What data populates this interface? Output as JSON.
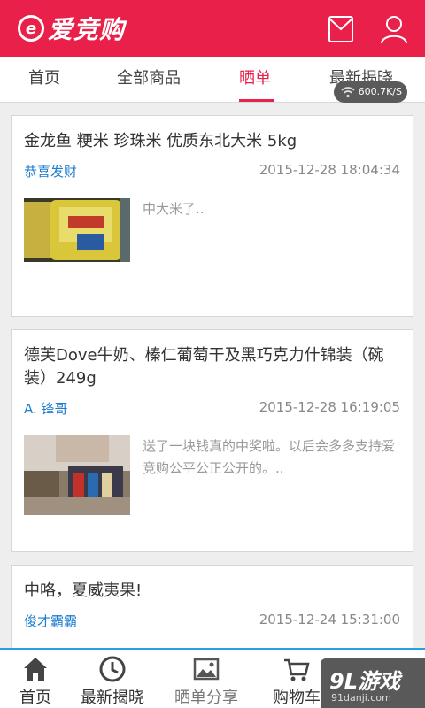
{
  "app": {
    "logo_mark": "e",
    "logo_text": "爱竞购"
  },
  "colors": {
    "brand": "#e8204a",
    "link": "#1e7ed0",
    "muted": "#999999",
    "accent_line": "#2aa0e0"
  },
  "header_icons": [
    "mail-icon",
    "user-icon"
  ],
  "tabs": [
    {
      "label": "首页",
      "active": false
    },
    {
      "label": "全部商品",
      "active": false
    },
    {
      "label": "晒单",
      "active": true
    },
    {
      "label": "最新揭晓",
      "active": false
    }
  ],
  "status": {
    "net_speed": "600.7K/S"
  },
  "posts": [
    {
      "title": "金龙鱼 粳米 珍珠米 优质东北大米 5kg",
      "user": "恭喜发财",
      "time": "2015-12-28 18:04:34",
      "excerpt": "中大米了.."
    },
    {
      "title": "德芙Dove牛奶、榛仁葡萄干及黑巧克力什锦装（碗装）249g",
      "user": "A. 锋哥",
      "time": "2015-12-28 16:19:05",
      "excerpt": "送了一块钱真的中奖啦。以后会多多支持爱竞购公平公正公开的。.."
    },
    {
      "title": "中咯，夏威夷果!",
      "user": "俊才霸霸",
      "time": "2015-12-24 15:31:00",
      "excerpt": ""
    }
  ],
  "bottom_nav": [
    {
      "label": "首页",
      "icon": "home-icon"
    },
    {
      "label": "最新揭晓",
      "icon": "clock-icon"
    },
    {
      "label": "晒单分享",
      "icon": "image-icon"
    },
    {
      "label": "购物车",
      "icon": "cart-icon"
    }
  ],
  "watermark": {
    "big": "9L游戏",
    "small": "91danji.com"
  }
}
